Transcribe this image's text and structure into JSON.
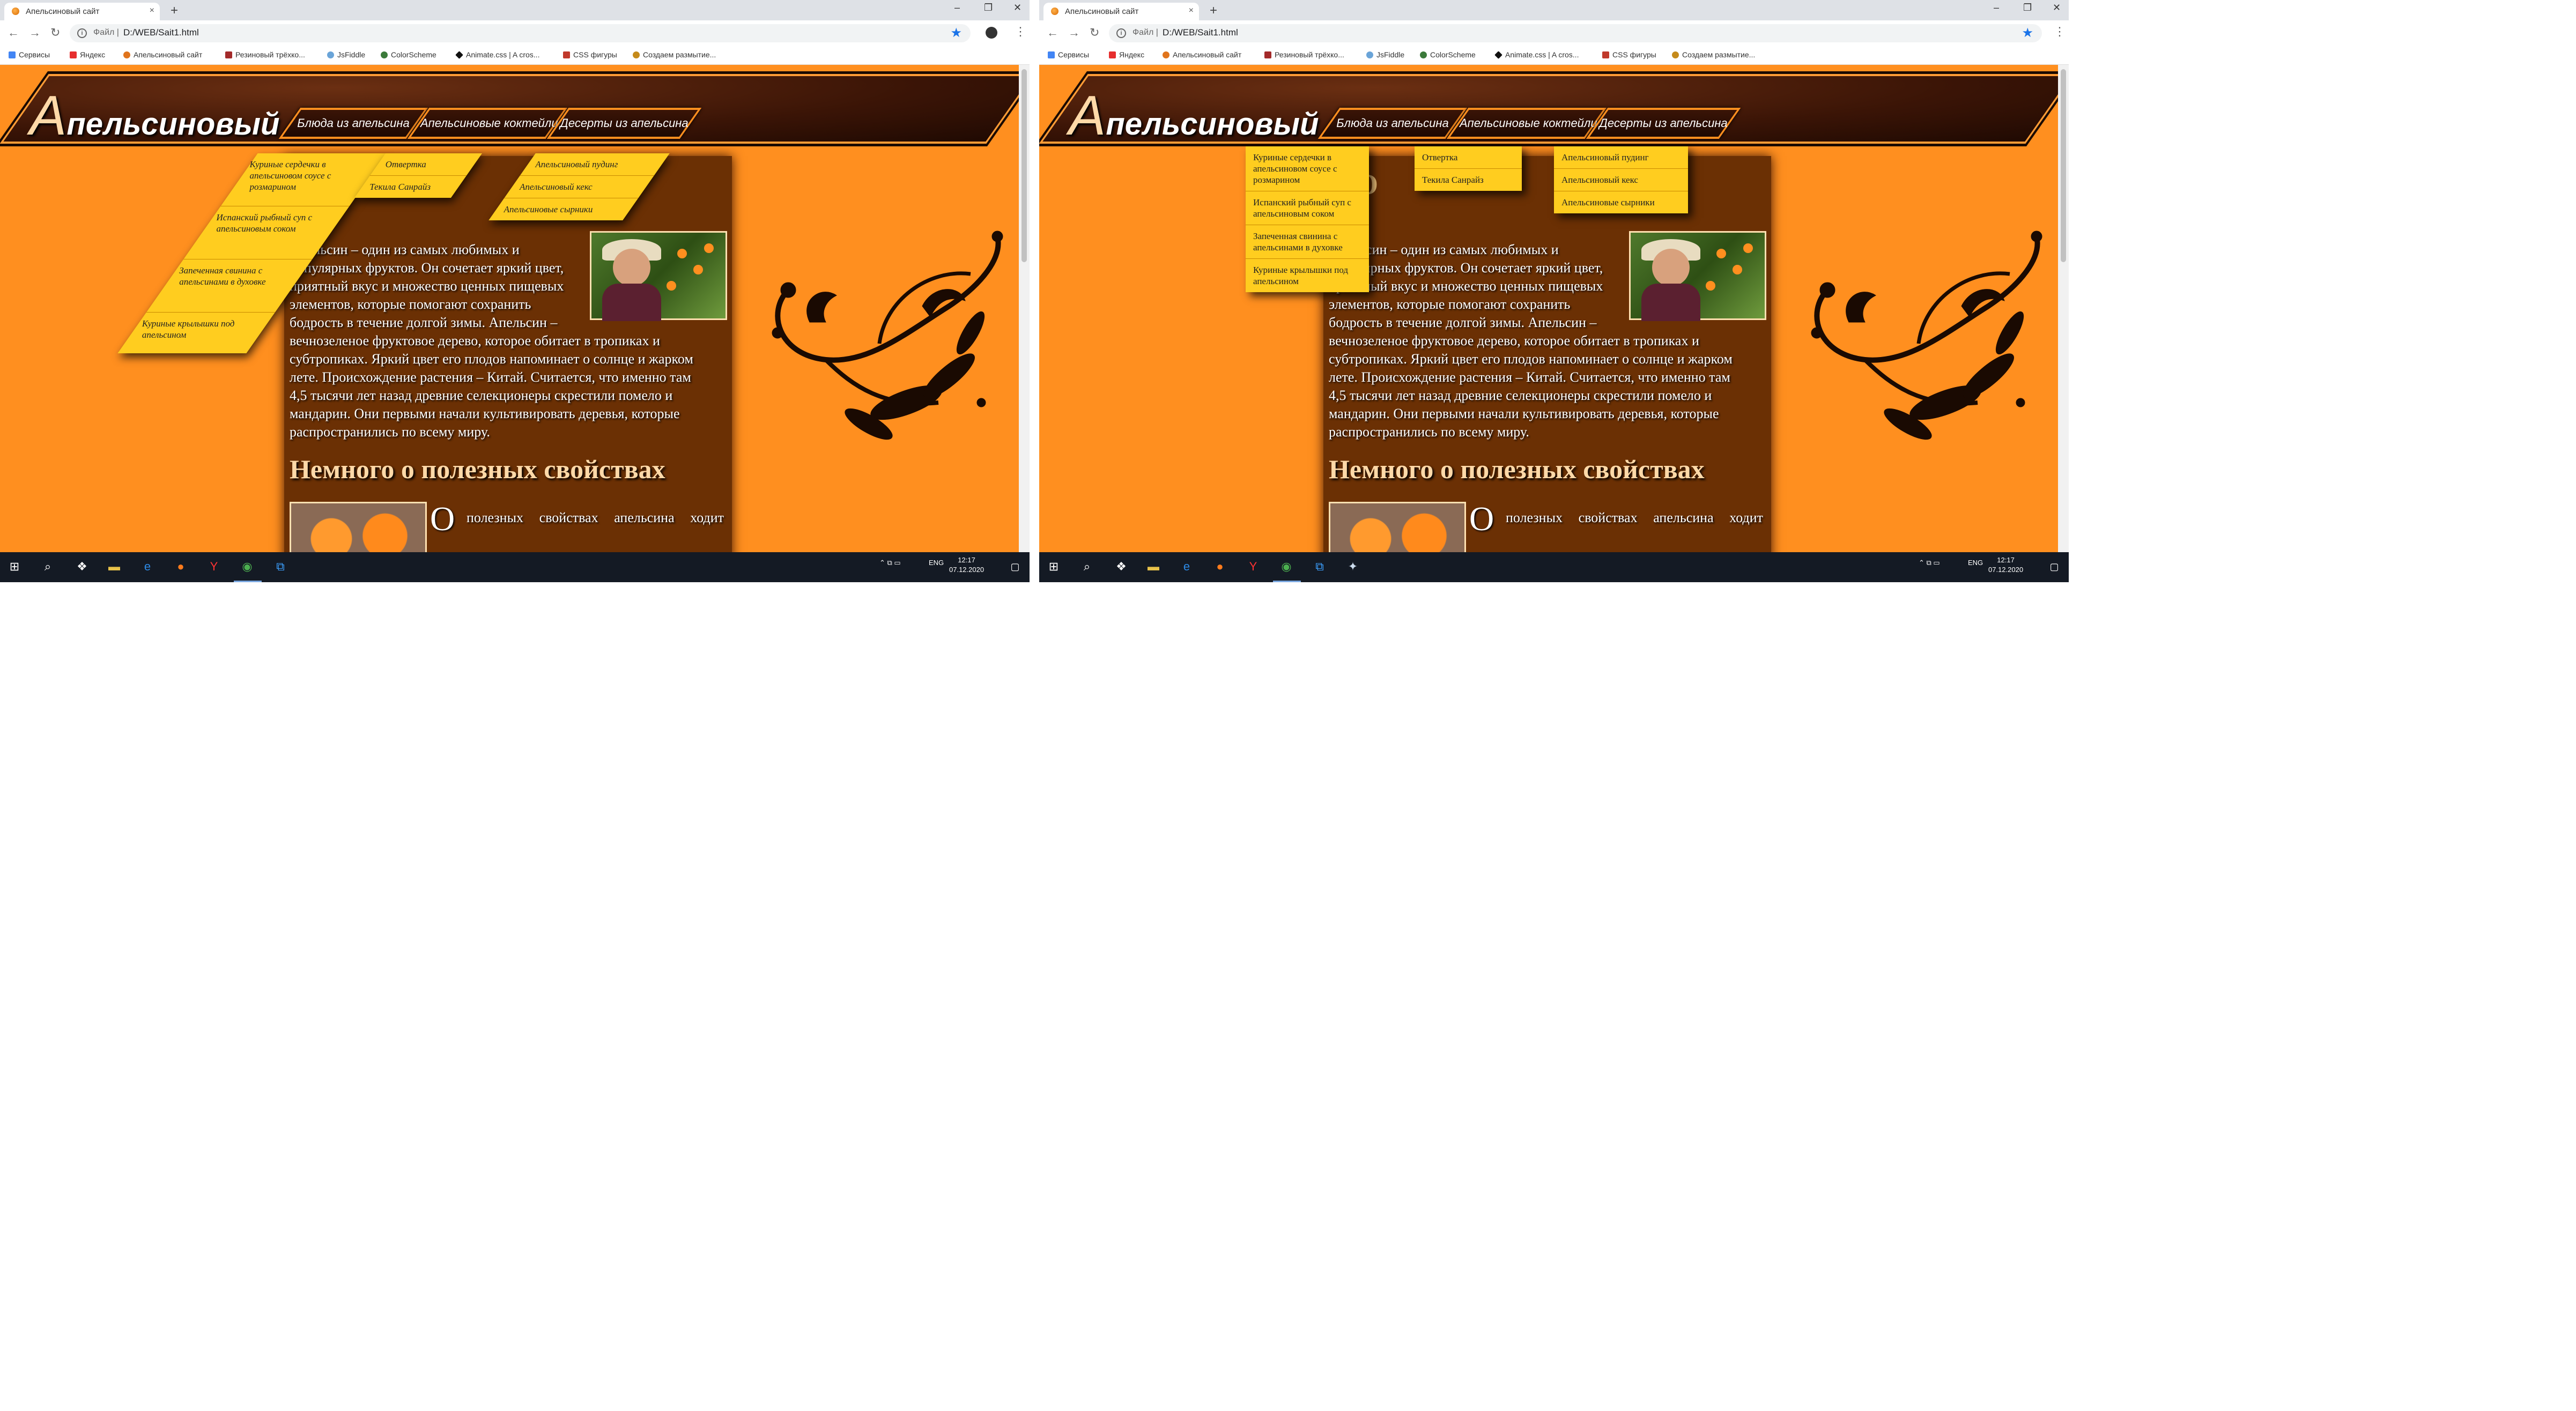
{
  "browser": {
    "tab_title": "Апельсиновый сайт",
    "tab_close": "×",
    "new_tab": "+",
    "window_controls": [
      "–",
      "❐",
      "✕"
    ],
    "nav": {
      "back": "←",
      "forward": "→",
      "reload": "↻"
    },
    "scheme_label": "Файл",
    "url": "D:/WEB/Sait1.html",
    "star": "★",
    "menu": "⋮"
  },
  "bookmarks": [
    {
      "label": "Сервисы",
      "icon": "apps-icon",
      "color": "#4285f4"
    },
    {
      "label": "Яндекс",
      "icon": "yandex-icon",
      "color": "#e62e2e"
    },
    {
      "label": "Апельсиновый сайт",
      "icon": "orange-icon",
      "color": "#e0741c"
    },
    {
      "label": "Резиновый трёхко...",
      "icon": "bookmark-icon",
      "color": "#a32a2a"
    },
    {
      "label": "JsFiddle",
      "icon": "cloud-icon",
      "color": "#6aa4d8"
    },
    {
      "label": "ColorScheme",
      "icon": "palette-icon",
      "color": "#3b7a3a"
    },
    {
      "label": "Animate.css | A cros...",
      "icon": "diamond-icon",
      "color": "#111111"
    },
    {
      "label": "CSS фигуры",
      "icon": "page-icon",
      "color": "#c0392b"
    },
    {
      "label": "Создаем размытие...",
      "icon": "gear-icon",
      "color": "#c58a1a"
    }
  ],
  "site": {
    "title_cap": "А",
    "title_rest": "пельсиновый сайт",
    "nav": [
      "Блюда из апельсина",
      "Апельсиновые коктейли",
      "Десерты из апельсина"
    ],
    "hidden_heading": "О",
    "menus": {
      "dishes": [
        "Куриные сердечки в апельсиновом соусе с розмарином",
        "Испанский рыбный суп с апельсиновым соком",
        "Запеченная свинина с апельсинами в духовке",
        "Куриные крылышки под апельсином"
      ],
      "cocktails": [
        "Отвертка",
        "Текила Санрайз"
      ],
      "desserts": [
        "Апельсиновый пудинг",
        "Апельсиновый кекс",
        "Апельсиновые сырники"
      ]
    },
    "left_paragraph_lines": [
      "Апельсин – один из самых любимых и",
      "популярных фруктов. Он сочетает яркий цвет,",
      "приятный вкус и множество ценных пищевых",
      "элементов, которые помогают сохранить",
      "бодрость в течение долгой зимы. Апельсин –",
      "вечнозеленое фруктовое дерево, которое обитает в тропиках и",
      "субтропиках. Яркий цвет его плодов напоминает о солнце и жарком",
      "лете. Происхождение растения – Китай. Считается, что именно там",
      "4,5 тысячи лет назад древние селекционеры скрестили помело и",
      "мандарин. Они первыми начали культивировать деревья, которые",
      "распространились по всему миру."
    ],
    "section_heading": "Немного о полезных свойствах",
    "dropcap": "О",
    "dropcap_line": "полезных свойствах апельсина ходит"
  },
  "taskbar": {
    "tray": "ENG",
    "time": "12:17",
    "date": "07.12.2020"
  }
}
